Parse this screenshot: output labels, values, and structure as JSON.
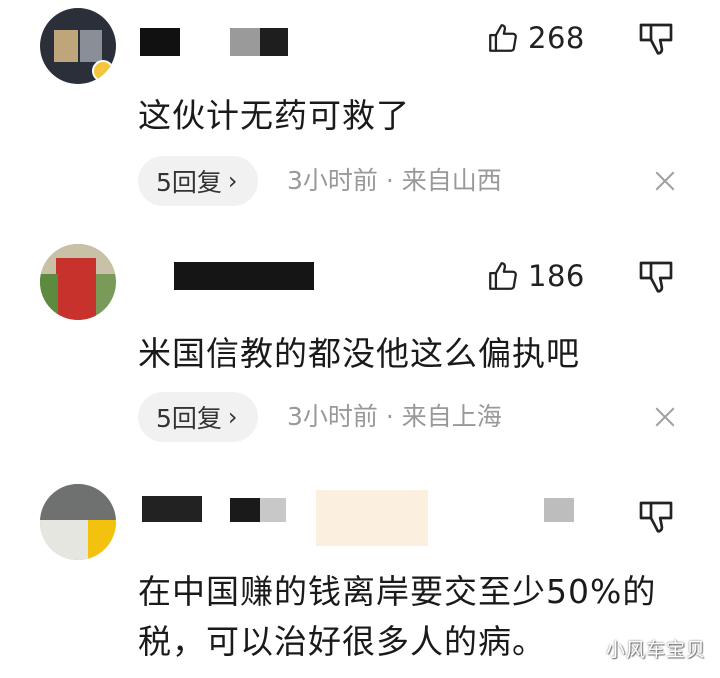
{
  "comments": [
    {
      "likes": "268",
      "text": "这伙计无药可救了",
      "replies": "5回复",
      "meta": "3小时前 · 来自山西"
    },
    {
      "likes": "186",
      "text": "米国信教的都没他这么偏执吧",
      "replies": "5回复",
      "meta": "3小时前 · 来自上海"
    },
    {
      "text_line1": "在中国赚的钱离岸要交至少50%的",
      "text_line2": "税，可以治好很多人的病。"
    }
  ],
  "watermark": "小风车宝贝",
  "icons": {
    "like": "thumbs-up-icon",
    "dislike": "thumbs-down-icon",
    "dismiss": "close-icon",
    "chevron": "chevron-right-icon"
  },
  "colors": {
    "text": "#1a1a1a",
    "meta": "#999999",
    "pill_bg": "#f1f1f1"
  }
}
